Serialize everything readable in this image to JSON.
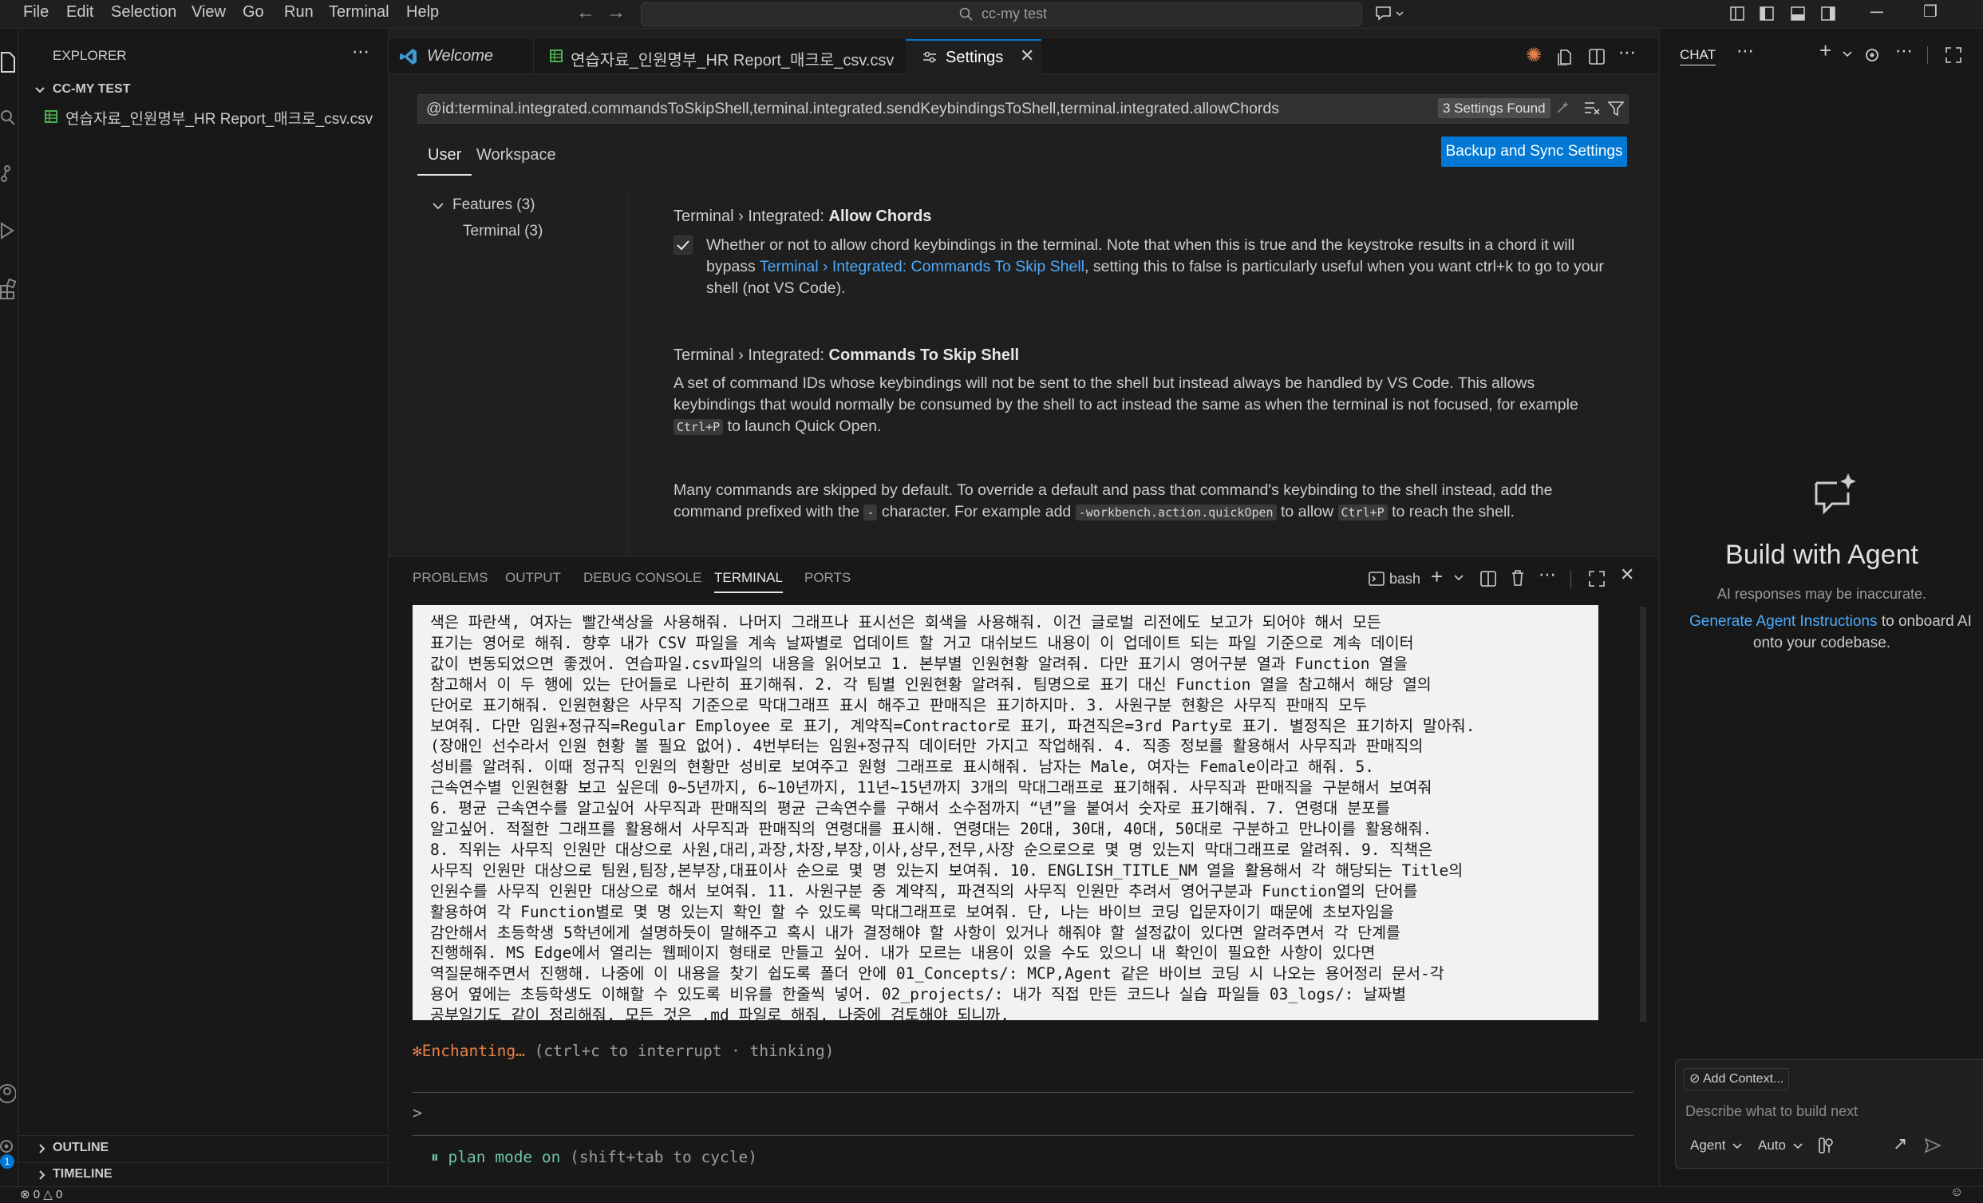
{
  "menu": [
    "File",
    "Edit",
    "Selection",
    "View",
    "Go",
    "Run",
    "Terminal",
    "Help"
  ],
  "command_center": "cc-my test",
  "explorer": {
    "title": "EXPLORER",
    "folder": "CC-MY TEST",
    "file": "연습자료_인원명부_HR Report_매크로_csv.csv",
    "outline": "OUTLINE",
    "timeline": "TIMELINE"
  },
  "tabs": [
    {
      "label": "Welcome"
    },
    {
      "label": "연습자료_인원명부_HR Report_매크로_csv.csv"
    },
    {
      "label": "Settings"
    }
  ],
  "settings": {
    "search_value": "@id:terminal.integrated.commandsToSkipShell,terminal.integrated.sendKeybindingsToShell,terminal.integrated.allowChords",
    "found_badge": "3 Settings Found",
    "scope_user": "User",
    "scope_workspace": "Workspace",
    "backup_button": "Backup and Sync Settings",
    "toc_features": "Features (3)",
    "toc_terminal": "Terminal (3)",
    "s1_prefix": "Terminal › Integrated: ",
    "s1_name": "Allow Chords",
    "s1_checked": true,
    "s1_line1": "Whether or not to allow chord keybindings in the terminal. Note that when this is true and the keystroke results in a chord it will",
    "s1_line2_a": "bypass ",
    "s1_line2_link": "Terminal › Integrated: Commands To Skip Shell",
    "s1_line2_b": ", setting this to false is particularly useful when you want ctrl+k to go to your",
    "s1_line3": "shell (not VS Code).",
    "s2_prefix": "Terminal › Integrated: ",
    "s2_name": "Commands To Skip Shell",
    "s2_line1": "A set of command IDs whose keybindings will not be sent to the shell but instead always be handled by VS Code. This allows",
    "s2_line2": "keybindings that would normally be consumed by the shell to act instead the same as when the terminal is not focused, for example",
    "s2_kb1": "Ctrl+P",
    "s2_line3_rest": " to launch Quick Open.",
    "s2_p2_line1": "Many commands are skipped by default. To override a default and pass that command's keybinding to the shell instead, add the",
    "s2_p2_line2_a": "command prefixed with the ",
    "s2_p2_kb_dash": "-",
    "s2_p2_line2_b": " character. For example add ",
    "s2_p2_kb_cmd": "-workbench.action.quickOpen",
    "s2_p2_line2_c": " to allow ",
    "s2_p2_kb_ctrlp": "Ctrl+P",
    "s2_p2_line2_d": " to reach the shell."
  },
  "panel": {
    "tabs": [
      "PROBLEMS",
      "OUTPUT",
      "DEBUG CONSOLE",
      "TERMINAL",
      "PORTS"
    ],
    "shell": "bash"
  },
  "terminal": {
    "lines": [
      "색은 파란색, 여자는 빨간색상을 사용해줘. 나머지 그래프나 표시선은 회색을 사용해줘. 이건 글로벌 리전에도 보고가 되어야 해서 모든",
      "표기는 영어로 해줘. 향후 내가 CSV 파일을 계속 날짜별로 업데이트 할 거고 대쉬보드 내용이 이 업데이트 되는 파일 기준으로 계속 데이터",
      "값이 변동되었으면 좋겠어. 연습파일.csv파일의 내용을 읽어보고 1. 본부별 인원현황 알려줘. 다만 표기시 영어구분 열과 Function 열을",
      "참고해서 이 두 행에 있는 단어들로 나란히 표기해줘. 2. 각 팀별 인원현황 알려줘. 팀명으로 표기 대신 Function 열을 참고해서 해당 열의",
      "단어로 표기해줘. 인원현황은 사무직 기준으로 막대그래프 표시 해주고 판매직은 표기하지마. 3. 사원구분 현황은 사무직 판매직 모두",
      "보여줘. 다만 임원+정규직=Regular Employee 로 표기, 계약직=Contractor로 표기, 파견직은=3rd Party로 표기. 별정직은 표기하지 말아줘.",
      "(장애인 선수라서 인원 현황 볼 필요 없어). 4번부터는 임원+정규직 데이터만 가지고 작업해줘. 4. 직종 정보를 활용해서 사무직과 판매직의",
      "성비를 알려줘. 이때 정규직 인원의 현황만 성비로 보여주고 원형 그래프로 표시해줘. 남자는 Male, 여자는 Female이라고 해줘. 5.",
      "근속연수별 인원현황 보고 싶은데 0~5년까지, 6~10년까지, 11년~15년까지 3개의 막대그래프로 표기해줘. 사무직과 판매직을 구분해서 보여줘",
      "6. 평균 근속연수를 알고싶어 사무직과 판매직의 평균 근속연수를 구해서 소수점까지 “년”을 붙여서 숫자로 표기해줘. 7. 연령대 분포를",
      "알고싶어. 적절한 그래프를 활용해서 사무직과 판매직의 연령대를 표시해. 연령대는 20대, 30대, 40대, 50대로 구분하고 만나이를 활용해줘.",
      "8. 직위는 사무직 인원만 대상으로 사원,대리,과장,차장,부장,이사,상무,전무,사장 순으로으로 몇 명 있는지 막대그래프로 알려줘. 9. 직책은",
      "사무직 인원만 대상으로 팀원,팀장,본부장,대표이사 순으로 몇 명 있는지 보여줘. 10. ENGLISH_TITLE_NM 열을 활용해서 각 해당되는 Title의",
      "인원수를 사무직 인원만 대상으로 해서 보여줘. 11. 사원구분 중 계약직, 파견직의 사무직 인원만 추려서 영어구분과 Function열의 단어를",
      "활용하여 각 Function별로 몇 명 있는지 확인 할 수 있도록 막대그래프로 보여줘. 단, 나는 바이브 코딩 입문자이기 때문에 초보자임을",
      "감안해서 초등학생 5학년에게 설명하듯이 말해주고 혹시 내가 결정해야 할 사항이 있거나 해줘야 할 설정값이 있다면 알려주면서 각 단계를",
      "진행해줘. MS Edge에서 열리는 웹페이지 형태로 만들고 싶어. 내가 모르는 내용이 있을 수도 있으니 내 확인이 필요한 사항이 있다면",
      "역질문해주면서 진행해. 나중에 이 내용을 찾기 쉽도록 폴더 안에 01_Concepts/: MCP,Agent 같은 바이브 코딩 시 나오는 용어정리 문서-각",
      "용어 옆에는 초등학생도 이해할 수 있도록 비유를 한줄씩 넣어. 02_projects/: 내가 직접 만든 코드나 실습 파일들 03_logs/: 날짜별",
      "공부일기도 같이 정리해줘. 모든 것은 .md 파일로 해줘. 나중에 검토해야 되니까."
    ],
    "status_word": "Enchanting…",
    "status_hint": " (ctrl+c to interrupt · thinking)",
    "prompt": ">",
    "mode_icon": "⏸",
    "mode_text": "plan mode on",
    "mode_hint": " (shift+tab to cycle)"
  },
  "chat": {
    "header": "CHAT",
    "title": "Build with Agent",
    "sub1": "AI responses may be inaccurate.",
    "link": "Generate Agent Instructions",
    "sub2_rest": " to onboard AI",
    "sub3": "onto your codebase.",
    "add_context": "Add Context...",
    "input_placeholder": "Describe what to build next",
    "agent": "Agent",
    "auto": "Auto"
  },
  "statusbar": {
    "errors": "0",
    "warnings": "0"
  },
  "colors": {
    "accent": "#0078d4",
    "link": "#4daafc",
    "status_orange": "#e8804a",
    "plan_green": "#6ec6a3"
  }
}
